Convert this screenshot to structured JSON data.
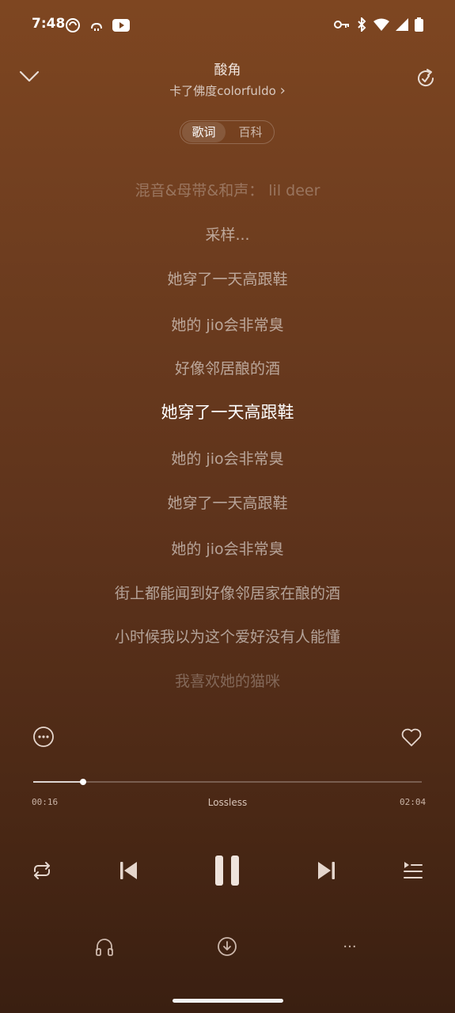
{
  "status_bar": {
    "time": "7:48",
    "icons_left": [
      "app-notification-icon",
      "weather-icon",
      "youtube-icon"
    ],
    "icons_right": [
      "vpn-key-icon",
      "bluetooth-icon",
      "wifi-icon",
      "signal-icon",
      "battery-icon"
    ]
  },
  "header": {
    "title": "酸角",
    "artist": "卡了佛度colorfuldo",
    "artist_chevron": "›"
  },
  "tabs": [
    {
      "label": "歌词",
      "active": true
    },
    {
      "label": "百科",
      "active": false
    }
  ],
  "lyrics": [
    {
      "text": "混音&母带&和声： lil deer",
      "state": "faded"
    },
    {
      "text": "采样...",
      "state": "normal"
    },
    {
      "text": "她穿了一天高跟鞋",
      "state": "normal"
    },
    {
      "text": "她的 jio会非常臭",
      "state": "normal"
    },
    {
      "text": "好像邻居酿的酒",
      "state": "normal"
    },
    {
      "text": "她穿了一天高跟鞋",
      "state": "current"
    },
    {
      "text": "她的 jio会非常臭",
      "state": "normal"
    },
    {
      "text": "她穿了一天高跟鞋",
      "state": "normal"
    },
    {
      "text": "她的 jio会非常臭",
      "state": "normal"
    },
    {
      "text": "街上都能闻到好像邻居家在酿的酒",
      "state": "normal"
    },
    {
      "text": "小时候我以为这个爱好没有人能懂",
      "state": "normal"
    },
    {
      "text": "我喜欢她的猫咪",
      "state": "faded"
    }
  ],
  "player": {
    "elapsed": "00:16",
    "duration": "02:04",
    "quality": "Lossless",
    "progress": 0.129
  },
  "bottom_more_label": "···"
}
